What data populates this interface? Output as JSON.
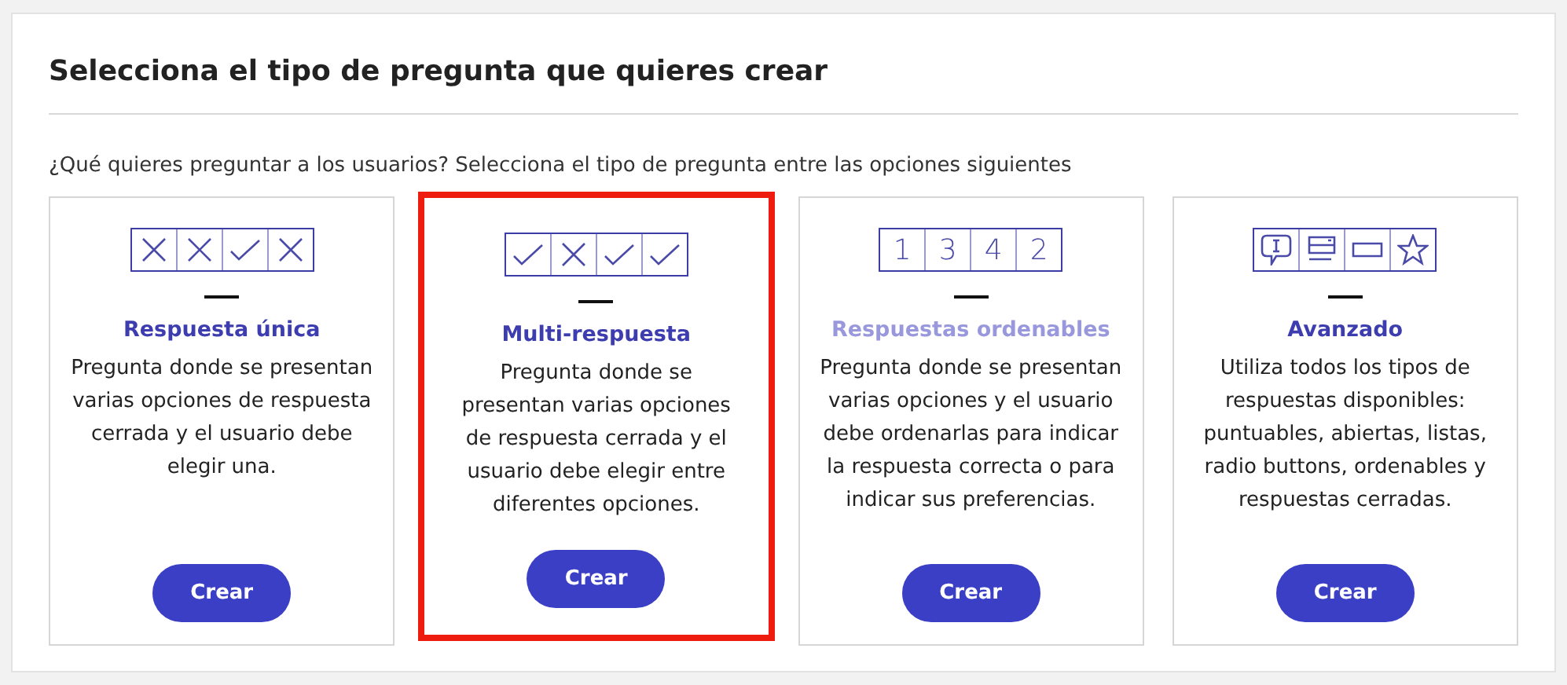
{
  "title": "Selecciona el tipo de pregunta que quieres crear",
  "subtitle": "¿Qué quieres preguntar a los usuarios? Selecciona el tipo de pregunta entre las opciones siguientes",
  "cards": [
    {
      "selected": false,
      "dimmed": false,
      "cells": [
        {
          "kind": "cross"
        },
        {
          "kind": "cross"
        },
        {
          "kind": "check"
        },
        {
          "kind": "cross"
        }
      ],
      "title": "Respuesta única",
      "description": "Pregunta donde se presentan varias opciones de respuesta cerrada y el usuario debe elegir una.",
      "button": "Crear"
    },
    {
      "selected": true,
      "dimmed": false,
      "cells": [
        {
          "kind": "check"
        },
        {
          "kind": "cross"
        },
        {
          "kind": "check"
        },
        {
          "kind": "check"
        }
      ],
      "title": "Multi-respuesta",
      "description": "Pregunta donde se presentan varias opciones de respuesta cerrada y el usuario debe elegir entre diferentes opciones.",
      "button": "Crear"
    },
    {
      "selected": false,
      "dimmed": true,
      "cells": [
        {
          "kind": "digit",
          "text": "1"
        },
        {
          "kind": "digit",
          "text": "3"
        },
        {
          "kind": "digit",
          "text": "4"
        },
        {
          "kind": "digit",
          "text": "2"
        }
      ],
      "title": "Respuestas ordenables",
      "description": "Pregunta donde se presentan varias opciones y el usuario debe ordenarlas para indicar la respuesta correcta o para indicar sus preferencias.",
      "button": "Crear"
    },
    {
      "selected": false,
      "dimmed": false,
      "cells": [
        {
          "kind": "speech"
        },
        {
          "kind": "list"
        },
        {
          "kind": "field"
        },
        {
          "kind": "star"
        }
      ],
      "title": "Avanzado",
      "description": "Utiliza todos los tipos de respuestas disponibles: puntuables, abiertas, listas, radio buttons, ordenables y respuestas cerradas.",
      "button": "Crear"
    }
  ]
}
